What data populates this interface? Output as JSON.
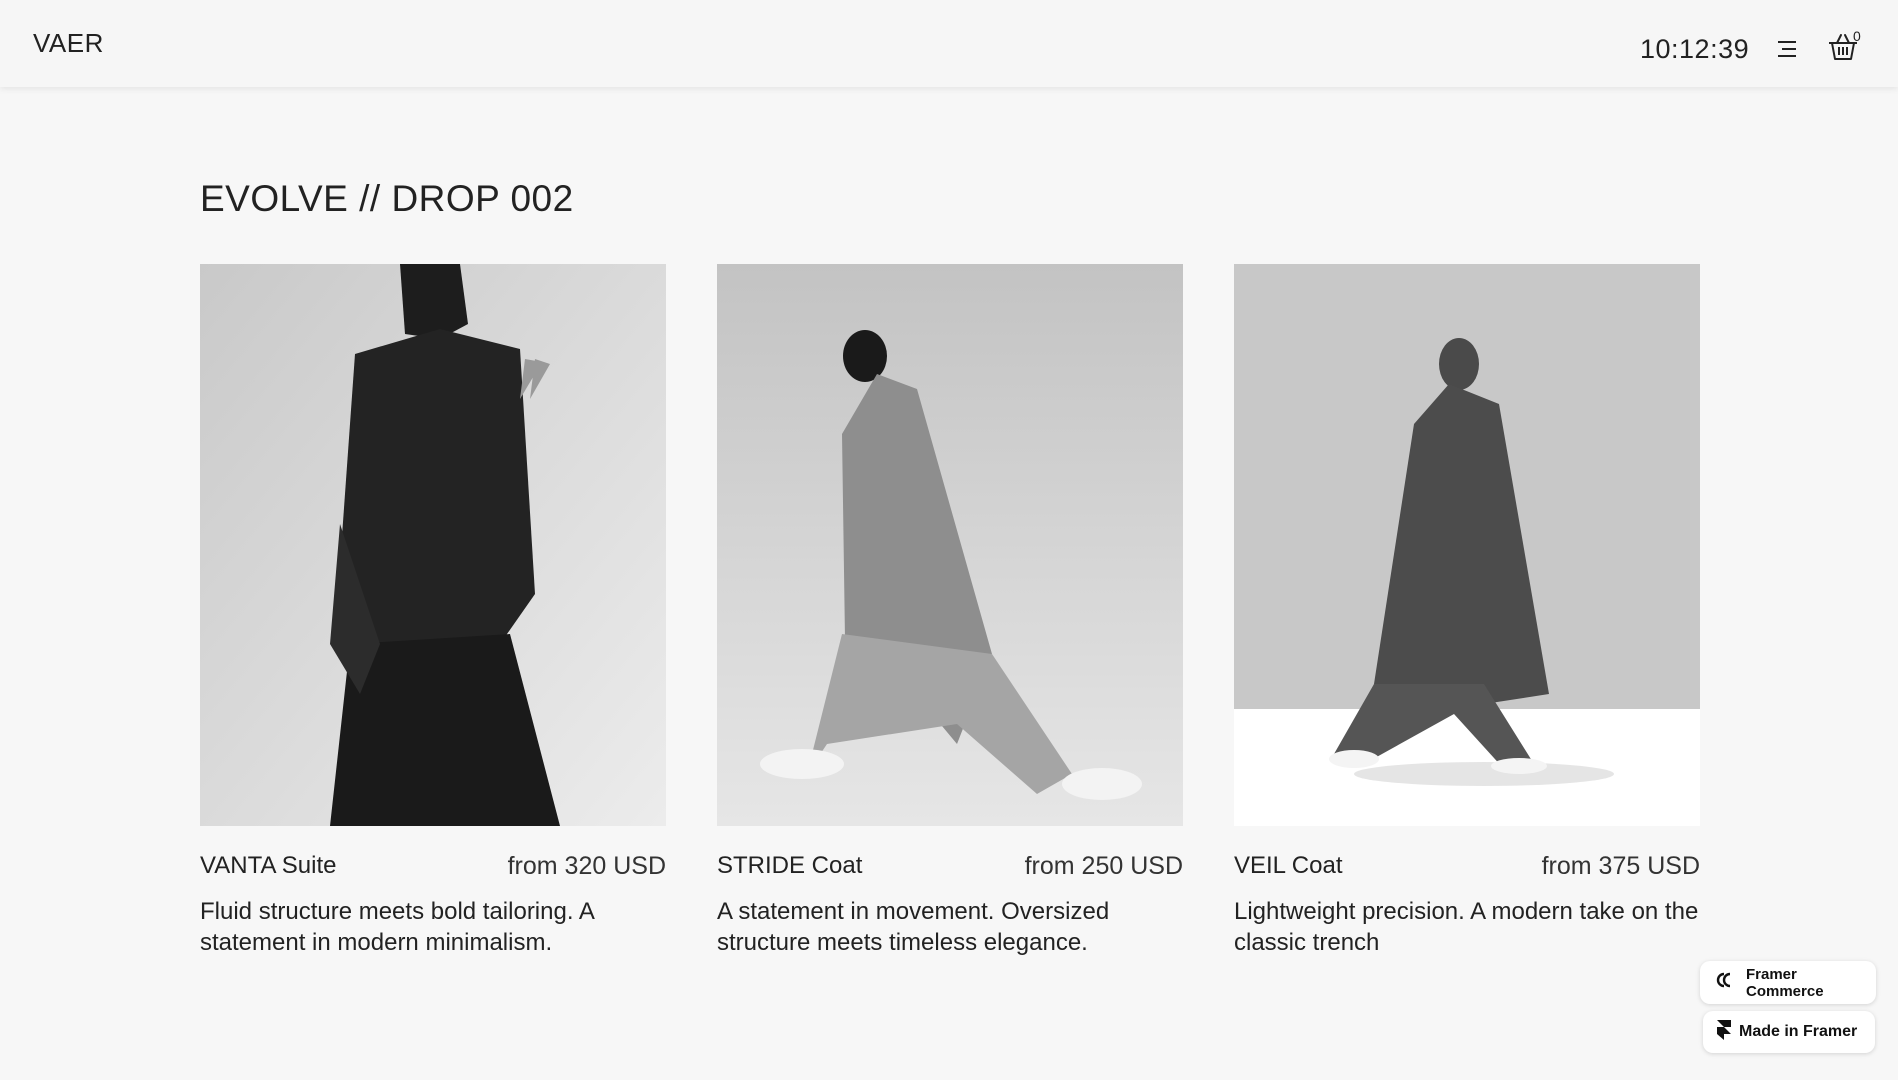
{
  "header": {
    "logo": "VAER",
    "clock": "10:12:39",
    "menu_icon": "menu-icon",
    "cart_icon": "basket-icon",
    "cart_count": "0"
  },
  "collection": {
    "title": "EVOLVE // DROP 002"
  },
  "products": [
    {
      "name": "VANTA Suite",
      "price": "from 320 USD",
      "description": "Fluid structure meets bold tailoring. A statement in modern minimalism."
    },
    {
      "name": "STRIDE Coat",
      "price": "from 250 USD",
      "description": "A statement in movement. Oversized structure meets timeless elegance."
    },
    {
      "name": "VEIL Coat",
      "price": "from 375 USD",
      "description": "Lightweight precision. A modern take on the classic trench"
    }
  ],
  "badges": {
    "framer_commerce": "Framer Commerce",
    "made_in_framer": "Made in Framer"
  }
}
